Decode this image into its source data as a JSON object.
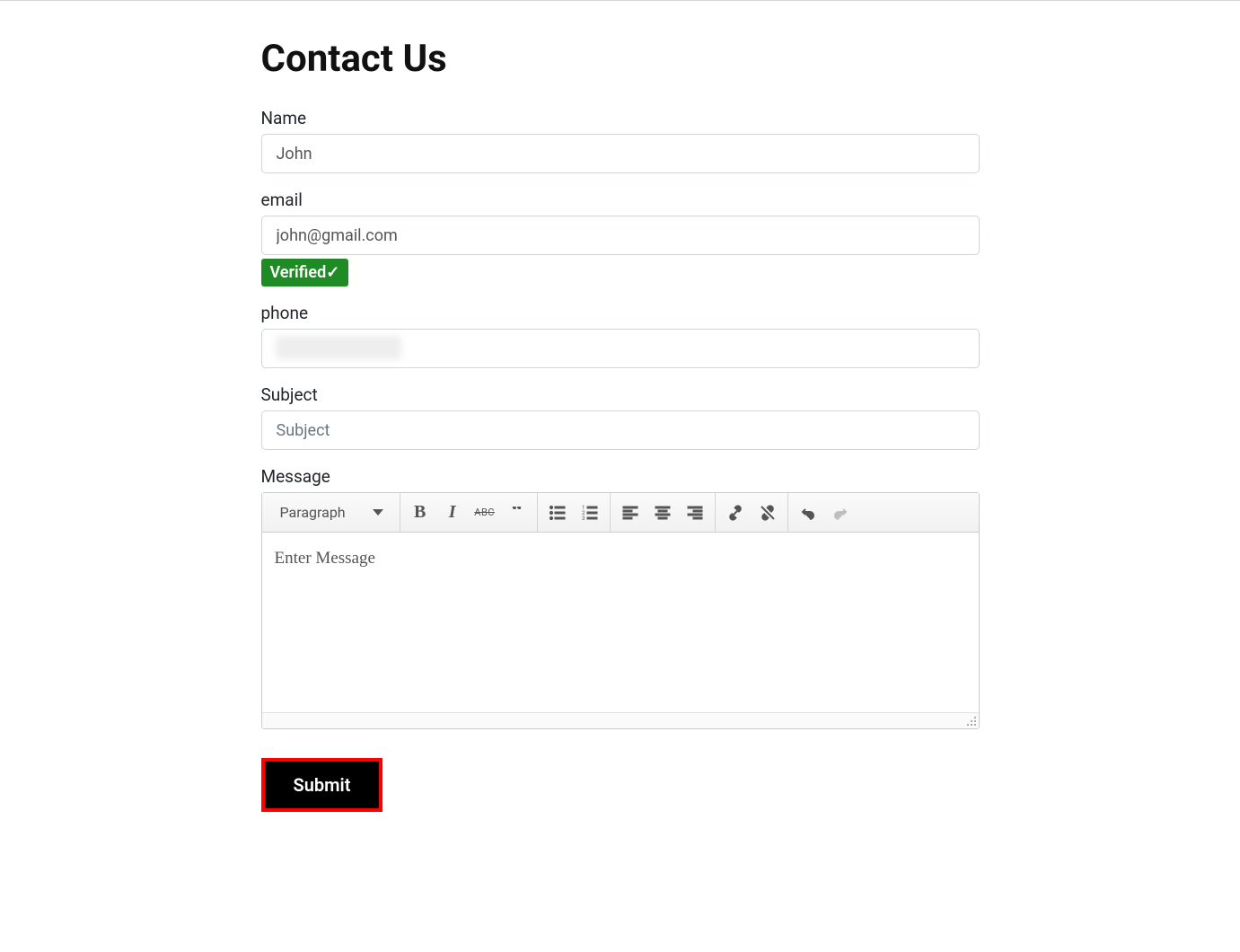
{
  "page": {
    "title": "Contact Us"
  },
  "fields": {
    "name": {
      "label": "Name",
      "value": "John"
    },
    "email": {
      "label": "email",
      "value": "john@gmail.com",
      "verified_text": "Verified✓"
    },
    "phone": {
      "label": "phone",
      "value": ""
    },
    "subject": {
      "label": "Subject",
      "placeholder": "Subject",
      "value": ""
    },
    "message": {
      "label": "Message",
      "placeholder": "Enter Message"
    }
  },
  "editor": {
    "format_select": "Paragraph",
    "buttons": {
      "bold": "B",
      "italic": "I",
      "strike": "ABC"
    }
  },
  "actions": {
    "submit": "Submit"
  }
}
